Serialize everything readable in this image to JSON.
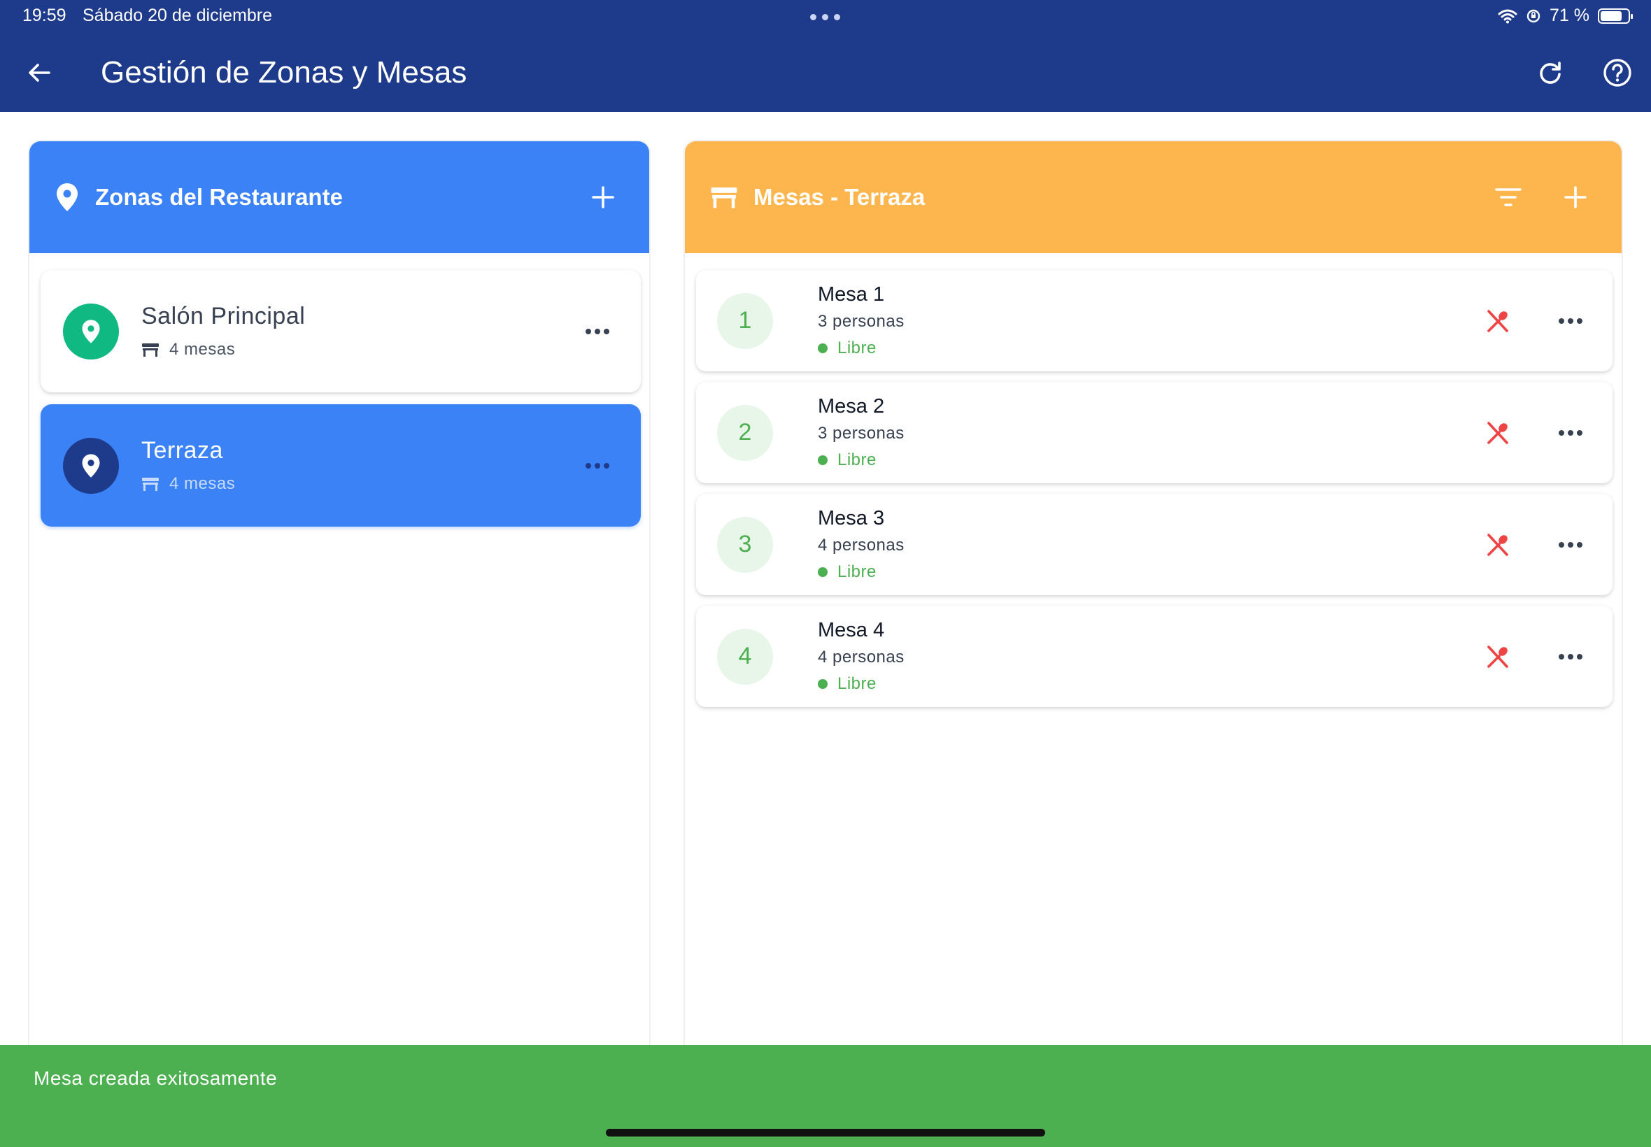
{
  "status_bar": {
    "time": "19:59",
    "date": "Sábado 20 de diciembre",
    "battery": "71 %"
  },
  "app_bar": {
    "title": "Gestión de Zonas y Mesas"
  },
  "colors": {
    "app_bar": "#1e3a8a",
    "zones_header": "#3b82f6",
    "tables_header": "#fdb64d",
    "free_status": "#4caf50",
    "occupied_action": "#ef4444",
    "snackbar": "#4caf50"
  },
  "zones_panel": {
    "title": "Zonas del Restaurante",
    "zones": [
      {
        "name": "Salón Principal",
        "tables": "4 mesas",
        "selected": false
      },
      {
        "name": "Terraza",
        "tables": "4 mesas",
        "selected": true
      }
    ]
  },
  "tables_panel": {
    "title": "Mesas - Terraza",
    "tables": [
      {
        "number": "1",
        "name": "Mesa 1",
        "capacity": "3 personas",
        "status": "Libre"
      },
      {
        "number": "2",
        "name": "Mesa 2",
        "capacity": "3 personas",
        "status": "Libre"
      },
      {
        "number": "3",
        "name": "Mesa 3",
        "capacity": "4 personas",
        "status": "Libre"
      },
      {
        "number": "4",
        "name": "Mesa 4",
        "capacity": "4 personas",
        "status": "Libre"
      }
    ]
  },
  "snackbar": {
    "message": "Mesa creada exitosamente"
  },
  "icons": {
    "back": "arrow-back-icon",
    "refresh": "refresh-icon",
    "help": "help-circle-icon",
    "zone": "location-pin-icon",
    "table": "table-icon",
    "add": "plus-icon",
    "filter": "filter-icon",
    "more": "more-horizontal-icon",
    "no_food": "utensils-off-icon"
  }
}
